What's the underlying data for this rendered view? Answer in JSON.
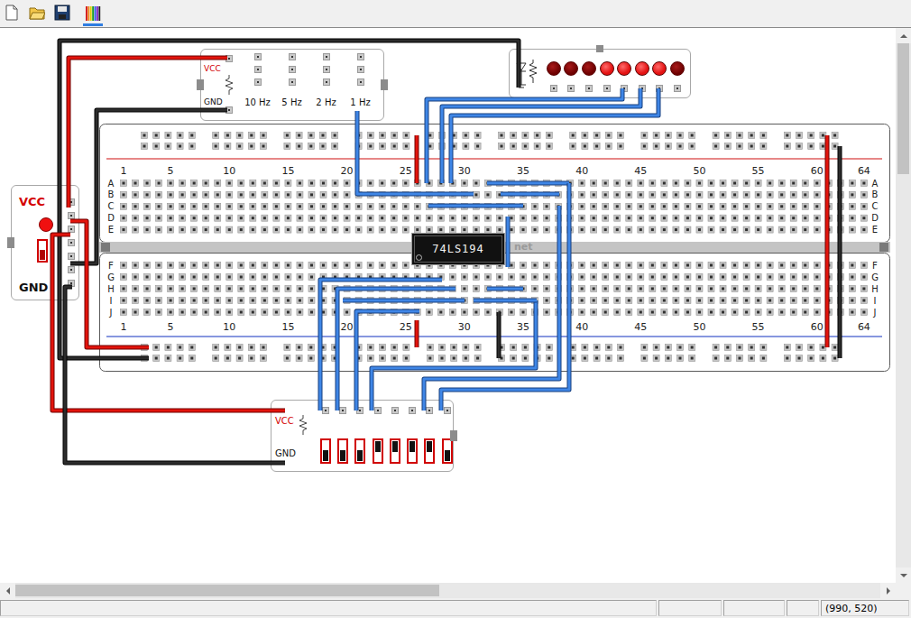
{
  "toolbar": [
    {
      "kind": "new",
      "selected": false
    },
    {
      "kind": "open",
      "selected": false
    },
    {
      "kind": "save",
      "selected": false
    },
    {
      "kind": "wires",
      "selected": true
    }
  ],
  "clock": {
    "vcc": "VCC",
    "gnd": "GND",
    "frequencies": [
      "10 Hz",
      "5 Hz",
      "2 Hz",
      "1 Hz"
    ]
  },
  "led_bar": {
    "leds": [
      {
        "on": false
      },
      {
        "on": false
      },
      {
        "on": false
      },
      {
        "on": true
      },
      {
        "on": true
      },
      {
        "on": true
      },
      {
        "on": true
      },
      {
        "on": false
      }
    ]
  },
  "power_supply": {
    "vcc": "VCC",
    "gnd": "GND",
    "led_on": true,
    "switch_on": true
  },
  "breadboard": {
    "column_labels": [
      "1",
      "5",
      "10",
      "15",
      "20",
      "25",
      "30",
      "35",
      "40",
      "45",
      "50",
      "55",
      "60",
      "64"
    ],
    "top_rows": [
      "A",
      "B",
      "C",
      "D",
      "E"
    ],
    "bottom_rows": [
      "F",
      "G",
      "H",
      "I",
      "J"
    ],
    "chip": "74LS194",
    "watermark": "net"
  },
  "switch_panel": {
    "vcc": "VCC",
    "gnd": "GND",
    "switches": [
      {
        "on": true
      },
      {
        "on": true
      },
      {
        "on": true
      },
      {
        "on": false
      },
      {
        "on": false
      },
      {
        "on": false
      },
      {
        "on": false
      },
      {
        "on": true
      }
    ]
  },
  "scrollbars": {
    "vertical": {
      "level": 0.25
    },
    "horizontal": {
      "level": 0.49
    }
  },
  "status_bar": {
    "position": "(990, 520)"
  }
}
